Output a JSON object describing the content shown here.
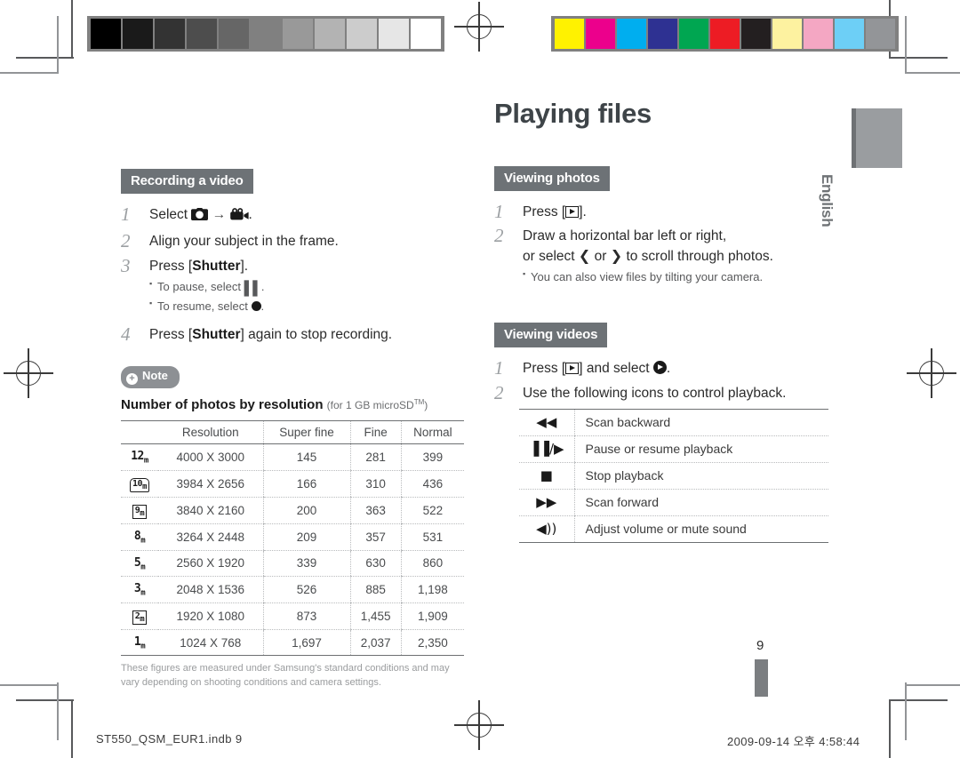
{
  "document": {
    "title": "Playing files",
    "language_tab": "English",
    "page_number": "9",
    "footer_left": "ST550_QSM_EUR1.indb   9",
    "footer_right": "2009-09-14   오후 4:58:44"
  },
  "calibration": {
    "grayscale": [
      "#000000",
      "#1a1a1a",
      "#333333",
      "#4d4d4d",
      "#666666",
      "#808080",
      "#999999",
      "#b3b3b3",
      "#cccccc",
      "#e6e6e6",
      "#ffffff"
    ],
    "colors": [
      "#fff200",
      "#ec008c",
      "#00aeef",
      "#2e3192",
      "#00a651",
      "#ed1c24",
      "#231f20",
      "#fdf2a0",
      "#f4a7c3",
      "#6dcff6",
      "#939598"
    ]
  },
  "left_column": {
    "section": "Recording a video",
    "steps": [
      {
        "num": "1",
        "text_before": "Select",
        "icon_a": "camera-icon",
        "arrow": "→",
        "icon_b": "camcorder-icon",
        "text_after": "."
      },
      {
        "num": "2",
        "text": "Align your subject in the frame."
      },
      {
        "num": "3",
        "text_before": "Press [",
        "bold": "Shutter",
        "text_after": "].",
        "bullets": [
          {
            "text_before": "To pause, select",
            "icon": "pause-icon",
            "text_after": "."
          },
          {
            "text_before": "To resume, select",
            "icon": "record-dot-icon",
            "text_after": "."
          }
        ]
      },
      {
        "num": "4",
        "text_before": "Press [",
        "bold": "Shutter",
        "text_after": "] again to stop recording."
      }
    ],
    "note": {
      "label": "Note",
      "title": "Number of photos by resolution",
      "subtitle_prefix": "(for 1 GB microSD",
      "subtitle_sup": "TM",
      "subtitle_suffix": ")",
      "table": {
        "headers": [
          "Resolution",
          "Super fine",
          "Fine",
          "Normal"
        ],
        "rows": [
          {
            "icon": "12m",
            "icon_style": "plain",
            "resolution": "4000 X 3000",
            "super_fine": "145",
            "fine": "281",
            "normal": "399"
          },
          {
            "icon": "10m",
            "icon_style": "round",
            "resolution": "3984 X 2656",
            "super_fine": "166",
            "fine": "310",
            "normal": "436"
          },
          {
            "icon": "9m",
            "icon_style": "boxed",
            "resolution": "3840 X 2160",
            "super_fine": "200",
            "fine": "363",
            "normal": "522"
          },
          {
            "icon": "8m",
            "icon_style": "plain",
            "resolution": "3264 X 2448",
            "super_fine": "209",
            "fine": "357",
            "normal": "531"
          },
          {
            "icon": "5m",
            "icon_style": "plain",
            "resolution": "2560 X 1920",
            "super_fine": "339",
            "fine": "630",
            "normal": "860"
          },
          {
            "icon": "3m",
            "icon_style": "plain",
            "resolution": "2048 X 1536",
            "super_fine": "526",
            "fine": "885",
            "normal": "1,198"
          },
          {
            "icon": "2m",
            "icon_style": "boxed",
            "resolution": "1920 X 1080",
            "super_fine": "873",
            "fine": "1,455",
            "normal": "1,909"
          },
          {
            "icon": "1m",
            "icon_style": "plain",
            "resolution": "1024 X 768",
            "super_fine": "1,697",
            "fine": "2,037",
            "normal": "2,350"
          }
        ]
      },
      "footnote": "These figures are measured under Samsung's standard conditions and may vary depending on shooting conditions and camera settings."
    }
  },
  "right_column": {
    "viewing_photos": {
      "section": "Viewing photos",
      "steps": [
        {
          "num": "1",
          "text_before": "Press [",
          "icon": "playback-key-icon",
          "text_after": "]."
        },
        {
          "num": "2",
          "line1": "Draw a horizontal bar left or right,",
          "line2_before": "or select",
          "icon_left": "chevron-left-icon",
          "line2_mid": "or",
          "icon_right": "chevron-right-icon",
          "line2_after": "to scroll through photos.",
          "bullets": [
            {
              "text": "You can also view files by tilting your camera."
            }
          ]
        }
      ]
    },
    "viewing_videos": {
      "section": "Viewing videos",
      "steps": [
        {
          "num": "1",
          "text_before": "Press [",
          "icon_key": "playback-key-icon",
          "text_mid": "] and select",
          "icon_play": "play-circle-icon",
          "text_after": "."
        },
        {
          "num": "2",
          "text": "Use the following icons to control playback."
        }
      ],
      "controls": [
        {
          "icon": "scan-backward-icon",
          "glyph": "◀◀",
          "label": "Scan backward"
        },
        {
          "icon": "pause-resume-icon",
          "glyph": "▐▐/▶",
          "label": "Pause or resume playback"
        },
        {
          "icon": "stop-icon",
          "glyph": "■",
          "label": "Stop playback"
        },
        {
          "icon": "scan-forward-icon",
          "glyph": "▶▶",
          "label": "Scan forward"
        },
        {
          "icon": "volume-icon",
          "glyph": "◀))",
          "label": "Adjust volume or mute sound"
        }
      ]
    }
  }
}
